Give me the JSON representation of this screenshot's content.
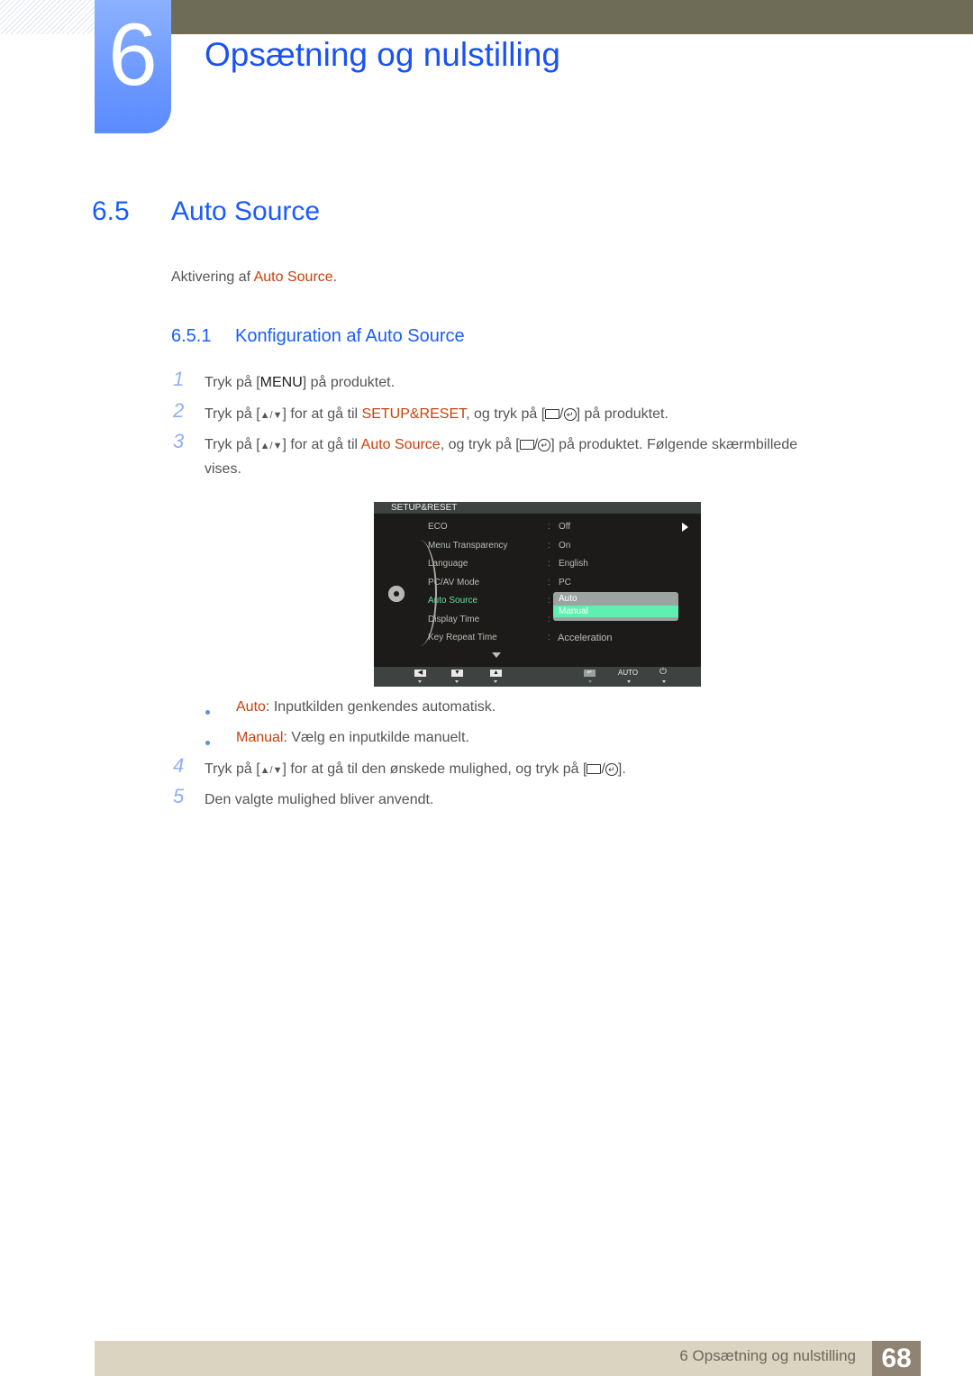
{
  "chapter": {
    "number": "6",
    "title": "Opsætning og nulstilling"
  },
  "section": {
    "number": "6.5",
    "title": "Auto Source",
    "intro_prefix": "Aktivering af ",
    "intro_highlight": "Auto Source",
    "intro_suffix": "."
  },
  "subsection": {
    "number": "6.5.1",
    "title": "Konfiguration af Auto Source"
  },
  "steps": [
    {
      "num": "1",
      "a": "Tryk på [",
      "key": "MENU",
      "b": "] på produktet."
    },
    {
      "num": "2",
      "a": "Tryk på [",
      "arrows": "▲/▼",
      "b": "] for at gå til ",
      "hl": "SETUP&RESET",
      "c": ", og tryk på [",
      "d": "] på produktet."
    },
    {
      "num": "3",
      "a": "Tryk på [",
      "arrows": "▲/▼",
      "b": "] for at gå til ",
      "hl": "Auto Source",
      "c": ", og tryk på [",
      "d": "] på produktet. Følgende skærmbillede",
      "e": "vises."
    },
    {
      "num": "4",
      "a": "Tryk på [",
      "arrows": "▲/▼",
      "b": "] for at gå til den ønskede mulighed, og tryk på [",
      "d": "]."
    },
    {
      "num": "5",
      "a": "Den valgte mulighed bliver anvendt."
    }
  ],
  "bullets": [
    {
      "term": "Auto",
      "desc": ": Inputkilden genkendes automatisk."
    },
    {
      "term": "Manual",
      "desc": ": Vælg en inputkilde manuelt."
    }
  ],
  "osd": {
    "header": "SETUP&RESET",
    "items": [
      {
        "label": "ECO",
        "value": "Off"
      },
      {
        "label": "Menu Transparency",
        "value": "On"
      },
      {
        "label": "Language",
        "value": "English"
      },
      {
        "label": "PC/AV Mode",
        "value": "PC"
      },
      {
        "label": "Auto Source",
        "value": ""
      },
      {
        "label": "Display Time",
        "value": ""
      },
      {
        "label": "Key Repeat Time",
        "value": "Acceleration"
      }
    ],
    "colon": ":",
    "dropdown": {
      "option1": "Auto",
      "option2": "Manual",
      "selected": "Manual"
    },
    "footer": {
      "auto_label": "AUTO",
      "left": "◀",
      "down": "▼",
      "up": "▲",
      "enter": "↵",
      "power": "⏻"
    }
  },
  "footer": {
    "text": "6 Opsætning og nulstilling",
    "page": "68"
  }
}
